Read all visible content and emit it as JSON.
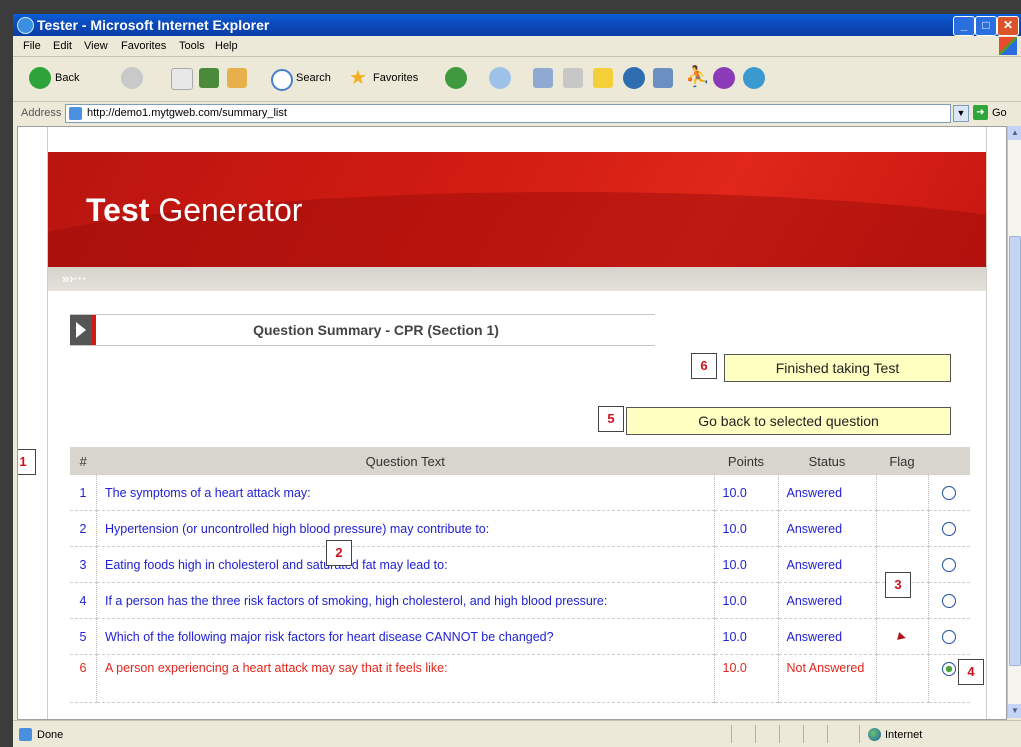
{
  "window": {
    "title": "Tester - Microsoft Internet Explorer"
  },
  "menubar": [
    "File",
    "Edit",
    "View",
    "Favorites",
    "Tools",
    "Help"
  ],
  "toolbar": {
    "back": "Back",
    "search": "Search",
    "favorites": "Favorites"
  },
  "address": {
    "label": "Address",
    "url": "http://demo1.mytgweb.com/summary_list",
    "go": "Go"
  },
  "status": {
    "text": "Done",
    "zone": "Internet"
  },
  "page": {
    "logo_bold": "Test",
    "logo_rest": "Generator",
    "heading": "Question Summary - CPR (Section 1)",
    "finished_button": "Finished taking Test",
    "go_back_button": "Go back to selected question",
    "callouts": [
      "1",
      "2",
      "3",
      "4",
      "5",
      "6"
    ],
    "columns": [
      "#",
      "Question Text",
      "Points",
      "Status",
      "Flag"
    ],
    "rows": [
      {
        "num": "1",
        "text": "The symptoms of a heart attack may:",
        "points": "10.0",
        "status": "Answered",
        "flagged": false,
        "selected": false
      },
      {
        "num": "2",
        "text": "Hypertension (or uncontrolled high blood pressure) may contribute to:",
        "points": "10.0",
        "status": "Answered",
        "flagged": false,
        "selected": false
      },
      {
        "num": "3",
        "text": "Eating foods high in cholesterol and saturated fat may lead to:",
        "points": "10.0",
        "status": "Answered",
        "flagged": false,
        "selected": false
      },
      {
        "num": "4",
        "text": "If a person has the three risk factors of smoking, high cholesterol, and high blood pressure:",
        "points": "10.0",
        "status": "Answered",
        "flagged": false,
        "selected": false
      },
      {
        "num": "5",
        "text": "Which of the following major risk factors for heart disease CANNOT be changed?",
        "points": "10.0",
        "status": "Answered",
        "flagged": true,
        "selected": false
      },
      {
        "num": "6",
        "text": "A person experiencing a heart attack may say that it feels like:",
        "points": "10.0",
        "status": "Not Answered",
        "flagged": false,
        "selected": true
      }
    ]
  },
  "colors": {
    "brand_red": "#d21c12",
    "link_blue": "#2121d6",
    "unanswered_red": "#e3241c",
    "button_yellow": "#ffffc2"
  }
}
